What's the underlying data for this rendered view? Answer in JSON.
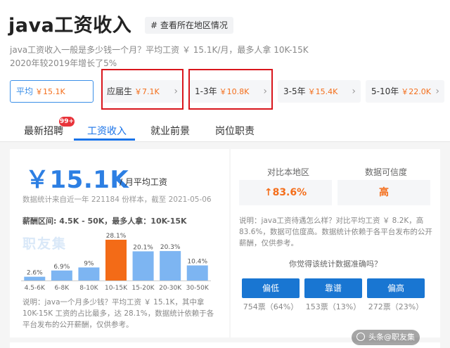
{
  "header": {
    "title": "java工资收入",
    "region_tag": "# 查看所在地区情况",
    "summary_line1": "java工资收入一般是多少钱一个月？平均工资 ￥ 15.1K/月，最多人拿 10K-15K",
    "summary_line2": "2020年较2019年增长了5%"
  },
  "experience_filters": [
    {
      "label": "平均",
      "value": "￥15.1K"
    },
    {
      "label": "应届生",
      "value": "￥7.1K"
    },
    {
      "label": "1-3年",
      "value": "￥10.8K"
    },
    {
      "label": "3-5年",
      "value": "￥15.4K"
    },
    {
      "label": "5-10年",
      "value": "￥22.0K"
    }
  ],
  "tabs": [
    {
      "label": "最新招聘"
    },
    {
      "label": "工资收入"
    },
    {
      "label": "就业前景"
    },
    {
      "label": "岗位职责"
    }
  ],
  "badge": "99+",
  "salary": {
    "amount": "￥15.1K",
    "unit": "/ 月平均工资",
    "source": "数据统计来自近一年 221184 份样本，截至 2021-05-06",
    "range": "薪酬区间: 4.5K - 50K，最多人拿：10K-15K",
    "watermark": "职友集",
    "description": "说明：java一个月多少钱？平均工资 ￥ 15.1K，其中拿 10K-15K 工资的占比最多，达 28.1%，数据统计依赖于各平台发布的公开薪酬，仅供参考。"
  },
  "chart_data": {
    "type": "bar",
    "categories": [
      "4.5-6K",
      "6-8K",
      "8-10K",
      "10-15K",
      "15-20K",
      "20-30K",
      "30-50K"
    ],
    "values": [
      2.6,
      6.9,
      9,
      28.1,
      20.1,
      20.3,
      10.4
    ],
    "value_labels": [
      "2.6%",
      "6.9%",
      "9%",
      "28.1%",
      "20.1%",
      "20.3%",
      "10.4%"
    ],
    "highlight_index": 3,
    "colors": {
      "normal": "#7db5f2",
      "highlight": "#f36b17"
    }
  },
  "comparison": {
    "local_label": "对比本地区",
    "local_value": "↑83.6%",
    "trust_label": "数据可信度",
    "trust_value": "高",
    "description": "说明：java工资待遇怎么样？对比平均工资 ￥ 8.2K，高 83.6%，数据可信度高。数据统计依赖于各平台发布的公开薪酬，仅供参考。",
    "question": "你觉得该统计数据准确吗？"
  },
  "votes": [
    {
      "label": "偏低",
      "count": "754票（64%）"
    },
    {
      "label": "靠谱",
      "count": "153票（13%）"
    },
    {
      "label": "偏高",
      "count": "272票（23%）"
    }
  ],
  "colors": {
    "accent_blue": "#1a73e8",
    "salary_blue": "#2d7fe3",
    "orange": "#f46e1b",
    "highlight_red": "#d9161c"
  }
}
